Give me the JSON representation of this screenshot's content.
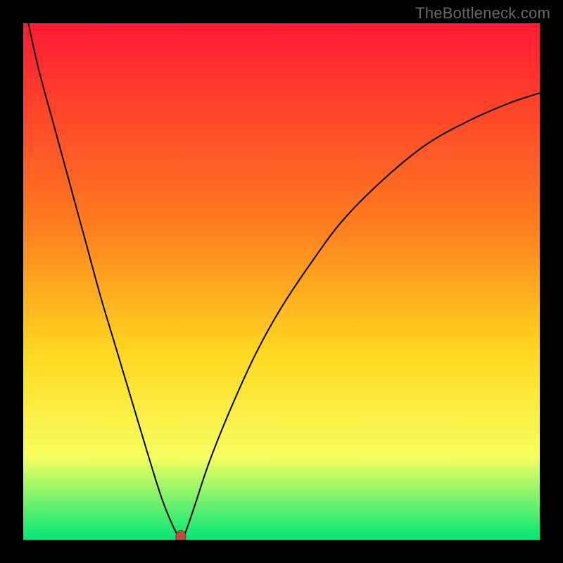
{
  "watermark": "TheBottleneck.com",
  "colors": {
    "background": "#000000",
    "gradient_top": "#ff1a33",
    "gradient_mid1": "#ff7a1f",
    "gradient_mid2": "#ffd820",
    "gradient_mid3": "#f6ff60",
    "gradient_bottom": "#00e676",
    "curve": "#000000",
    "marker_fill": "#c24a3a",
    "marker_stroke": "#8e2e24"
  },
  "chart_data": {
    "type": "line",
    "title": "",
    "xlabel": "",
    "ylabel": "",
    "xlim": [
      0,
      100
    ],
    "ylim": [
      0,
      100
    ],
    "grid": false,
    "legend": false,
    "series": [
      {
        "name": "bottleneck-curve",
        "x": [
          1,
          3,
          6,
          9,
          12,
          15,
          18,
          21,
          24,
          27,
          29.7,
          30.5,
          31.3,
          33,
          36,
          40,
          45,
          50,
          56,
          62,
          70,
          78,
          86,
          94,
          100
        ],
        "y": [
          100,
          91,
          80,
          69,
          58,
          47,
          37,
          27,
          17,
          7.5,
          1.2,
          0.6,
          1.2,
          6,
          15,
          25,
          36,
          45,
          54,
          62,
          70,
          76.5,
          81,
          84.5,
          86.5
        ]
      }
    ],
    "marker": {
      "x": 30.5,
      "y": 0.6
    },
    "background_gradient": {
      "stops": [
        {
          "offset": 0.0,
          "color": "#ff1a33"
        },
        {
          "offset": 0.38,
          "color": "#ff7a1f"
        },
        {
          "offset": 0.64,
          "color": "#ffd820"
        },
        {
          "offset": 0.84,
          "color": "#f6ff60"
        },
        {
          "offset": 1.0,
          "color": "#00e676"
        }
      ]
    }
  }
}
